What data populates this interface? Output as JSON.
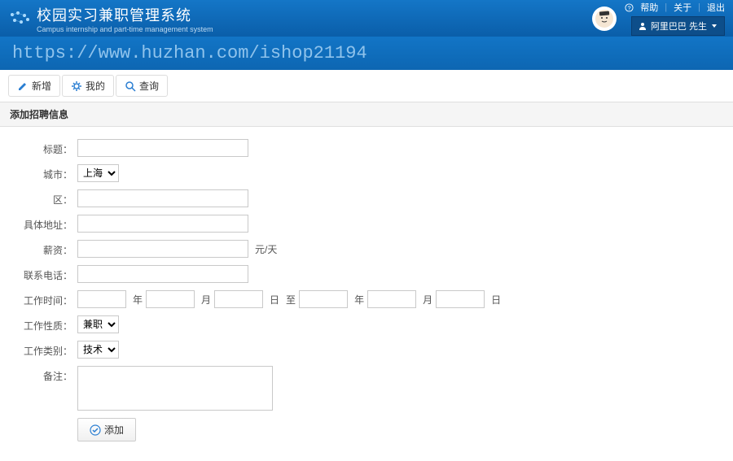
{
  "header": {
    "title": "校园实习兼职管理系统",
    "subtitle": "Campus internship and part-time management system",
    "help": "帮助",
    "about": "关于",
    "logout": "退出",
    "user": "阿里巴巴 先生"
  },
  "url": "https://www.huzhan.com/ishop21194",
  "toolbar": {
    "add": "新增",
    "mine": "我的",
    "search": "查询"
  },
  "section_title": "添加招聘信息",
  "form": {
    "title_label": "标题：",
    "city_label": "城市：",
    "city_value": "上海",
    "district_label": "区：",
    "address_label": "具体地址：",
    "salary_label": "薪资：",
    "salary_unit": "元/天",
    "phone_label": "联系电话：",
    "worktime_label": "工作时间：",
    "year_unit": "年",
    "month_unit": "月",
    "day_unit": "日",
    "to": "至",
    "worktype_label": "工作性质：",
    "worktype_value": "兼职",
    "category_label": "工作类别：",
    "category_value": "技术",
    "remark_label": "备注：",
    "submit": "添加"
  }
}
